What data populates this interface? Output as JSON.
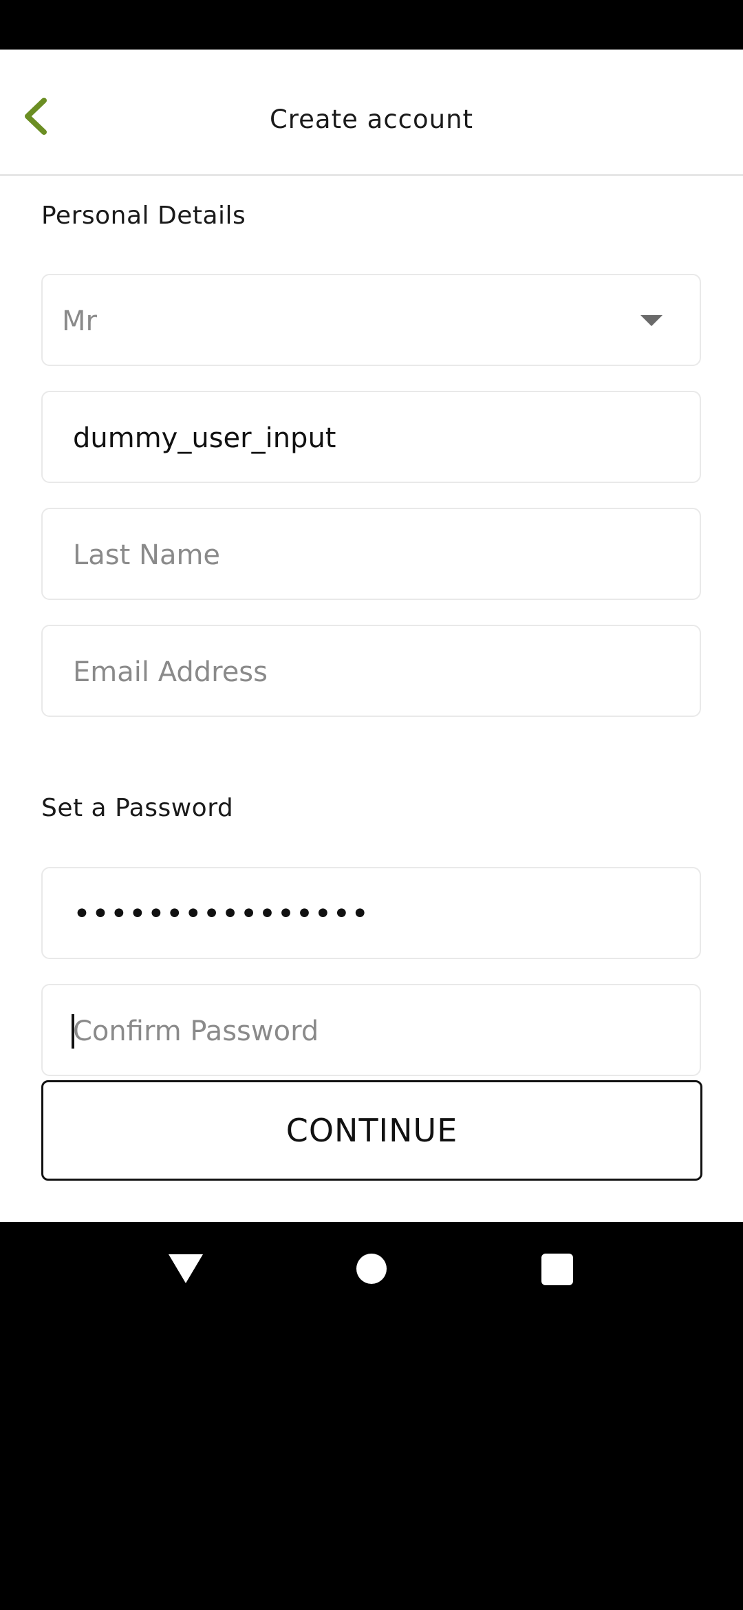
{
  "header": {
    "title": "Create account",
    "back_icon": "chevron-left-icon",
    "accent_color": "#6b8e23"
  },
  "personal_details": {
    "section_title": "Personal Details",
    "title_select": {
      "value": "Mr",
      "icon": "dropdown-caret-icon"
    },
    "first_name": {
      "value": "dummy_user_input"
    },
    "last_name": {
      "placeholder": "Last Name"
    },
    "email": {
      "placeholder": "Email Address"
    }
  },
  "password": {
    "section_title": "Set a Password",
    "password_field": {
      "masked_value": "••••••••••••••••"
    },
    "confirm_password": {
      "placeholder": "Confirm Password"
    }
  },
  "continue_button": {
    "label": "CONTINUE"
  },
  "nav_bar": {
    "back_icon": "triangle-back-icon",
    "home_icon": "circle-home-icon",
    "recents_icon": "square-recents-icon"
  }
}
